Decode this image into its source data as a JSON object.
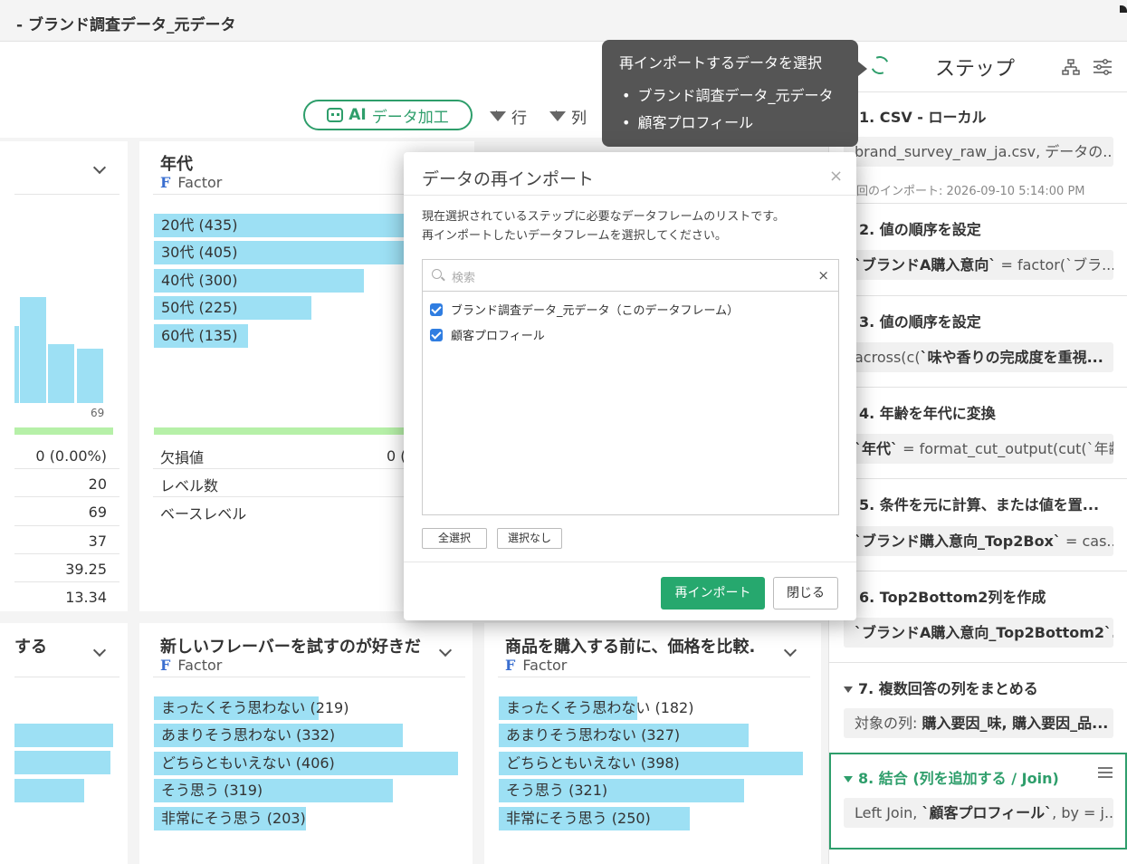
{
  "window_title": "- ブランド調査データ_元データ",
  "toolbar": {
    "ai_button_label_prefix": "AI",
    "ai_button_label": "データ加工",
    "row_filter_label": "行",
    "column_filter_label": "列"
  },
  "cards": {
    "age": {
      "title": "年代",
      "type": "Factor",
      "levels": [
        {
          "label": "20代 (435)",
          "count": 435
        },
        {
          "label": "30代 (405)",
          "count": 405
        },
        {
          "label": "40代 (300)",
          "count": 300
        },
        {
          "label": "50代 (225)",
          "count": 225
        },
        {
          "label": "60代 (135)",
          "count": 135
        }
      ],
      "stats": {
        "missing_label": "欠損値",
        "missing_value_partial": "0 (",
        "levels_label": "レベル数",
        "base_label": "ベースレベル"
      }
    },
    "left_numeric": {
      "histogram_label": "69",
      "stats": [
        "0 (0.00%)",
        "20",
        "69",
        "37",
        "39.25",
        "13.34"
      ]
    },
    "left_bottom": {
      "title": "する"
    },
    "flavor": {
      "title": "新しいフレーバーを試すのが好きだ",
      "type": "Factor",
      "levels": [
        {
          "label": "まったくそう思わない (219)",
          "count": 219
        },
        {
          "label": "あまりそう思わない (332)",
          "count": 332
        },
        {
          "label": "どちらともいえない (406)",
          "count": 406
        },
        {
          "label": "そう思う (319)",
          "count": 319
        },
        {
          "label": "非常にそう思う (203)",
          "count": 203
        }
      ]
    },
    "price": {
      "title": "商品を購入する前に、価格を比較.",
      "type": "Factor",
      "levels": [
        {
          "label": "まったくそう思わない (182)",
          "count": 182
        },
        {
          "label": "あまりそう思わない (327)",
          "count": 327
        },
        {
          "label": "どちらともいえない (398)",
          "count": 398
        },
        {
          "label": "そう思う (321)",
          "count": 321
        },
        {
          "label": "非常にそう思う (250)",
          "count": 250
        }
      ]
    }
  },
  "tooltip": {
    "title": "再インポートするデータを選択",
    "items": [
      "ブランド調査データ_元データ",
      "顧客プロフィール"
    ]
  },
  "modal": {
    "title": "データの再インポート",
    "close": "×",
    "description_line1": "現在選択されているステップに必要なデータフレームのリストです。",
    "description_line2": "再インポートしたいデータフレームを選択してください。",
    "search_placeholder": "検索",
    "search_clear": "×",
    "items": [
      {
        "label": "ブランド調査データ_元データ（このデータフレーム）",
        "checked": true
      },
      {
        "label": "顧客プロフィール",
        "checked": true
      }
    ],
    "select_all": "全選択",
    "select_none": "選択なし",
    "reimport": "再インポート",
    "close_button": "閉じる"
  },
  "steps_panel": {
    "title": "ステップ",
    "steps": [
      {
        "title": "1. CSV - ローカル",
        "detail_main": "brand_survey_raw_ja.csv, データの...",
        "time": "回のインポート: 2026-09-10 5:14:00 PM"
      },
      {
        "title": "2. 値の順序を設定",
        "detail_bold": "`ブランドA購入意向`",
        "detail_rest": " = factor(`ブラ..."
      },
      {
        "title": "3. 値の順序を設定",
        "detail_rest": "across(c(",
        "detail_bold": "`味や香りの完成度を重視..."
      },
      {
        "title": "4. 年齢を年代に変換",
        "detail_bold": "`年代`",
        "detail_rest": " = format_cut_output(cut(`年齢..."
      },
      {
        "title": "5. 条件を元に計算、または値を置...",
        "detail_bold": "`ブランド購入意向_Top2Box`",
        "detail_rest": " = cas..."
      },
      {
        "title": "6. Top2Bottom2列を作成",
        "detail_bold": "`ブランドA購入意向_Top2Bottom2`..."
      },
      {
        "title": "7. 複数回答の列をまとめる",
        "detail_rest": "対象の列: ",
        "detail_bold": "購入要因_味, 購入要因_品..."
      },
      {
        "title": "8. 結合 (列を追加する / Join)",
        "detail_rest": "Left Join, ",
        "detail_bold": "`顧客プロフィール`",
        "detail_tail": ", by = j..."
      }
    ]
  },
  "colors": {
    "accent_green": "#2e9e6b",
    "bar_blue": "#9de0f4",
    "checkbox_blue": "#2f7de1",
    "tooltip_bg": "#555555"
  }
}
